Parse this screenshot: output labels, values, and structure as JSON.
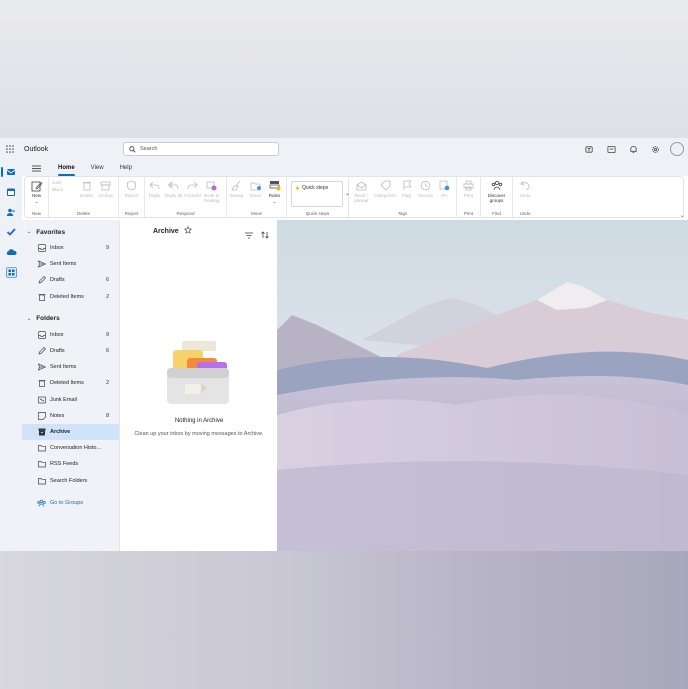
{
  "app": {
    "name": "Outlook"
  },
  "search": {
    "placeholder": "Search"
  },
  "titlebar_icons": [
    "teams-icon",
    "calendar-note-icon",
    "bell-icon",
    "gear-icon",
    "avatar"
  ],
  "ribbon": {
    "tabs": [
      "Home",
      "View",
      "Help"
    ],
    "selected_tab": "Home",
    "groups": [
      {
        "label": "New",
        "buttons": [
          "New"
        ]
      },
      {
        "label": "Delete",
        "buttons": [
          "Junk",
          "Block",
          "Delete",
          "Archive"
        ]
      },
      {
        "label": "Report",
        "buttons": [
          "Report"
        ]
      },
      {
        "label": "Respond",
        "buttons": [
          "Reply",
          "Reply all",
          "Forward",
          "Invite to meeting"
        ]
      },
      {
        "label": "Move",
        "buttons": [
          "Sweep",
          "Move",
          "Rules"
        ]
      },
      {
        "label": "Quick steps",
        "buttons": [
          "Quick steps"
        ]
      },
      {
        "label": "Tags",
        "buttons": [
          "Read / Unread",
          "Categorize",
          "Flag",
          "Snooze",
          "Pin"
        ]
      },
      {
        "label": "Print",
        "buttons": [
          "Print"
        ]
      },
      {
        "label": "Find",
        "buttons": [
          "Discover groups"
        ]
      },
      {
        "label": "Undo",
        "buttons": [
          "Undo"
        ]
      }
    ]
  },
  "folder_pane": {
    "favorites_label": "Favorites",
    "favorites": [
      {
        "label": "Inbox",
        "count": "9"
      },
      {
        "label": "Sent Items",
        "count": ""
      },
      {
        "label": "Drafts",
        "count": "6"
      },
      {
        "label": "Deleted Items",
        "count": "2"
      }
    ],
    "folders_label": "Folders",
    "folders": [
      {
        "label": "Inbox",
        "count": "9"
      },
      {
        "label": "Drafts",
        "count": "6"
      },
      {
        "label": "Sent Items",
        "count": ""
      },
      {
        "label": "Deleted Items",
        "count": "2"
      },
      {
        "label": "Junk Email",
        "count": ""
      },
      {
        "label": "Notes",
        "count": "8"
      },
      {
        "label": "Archive",
        "count": ""
      },
      {
        "label": "Conversation Histo...",
        "count": ""
      },
      {
        "label": "RSS Feeds",
        "count": ""
      },
      {
        "label": "Search Folders",
        "count": ""
      }
    ],
    "selected_folder": "Archive",
    "groups_link": "Go to Groups"
  },
  "message_list": {
    "title": "Archive",
    "empty_title": "Nothing in Archive",
    "empty_subtitle": "Clean up your inbox by moving messages to Archive."
  },
  "colors": {
    "accent": "#0f6cbd",
    "selected_bg": "#cfe4fa"
  }
}
